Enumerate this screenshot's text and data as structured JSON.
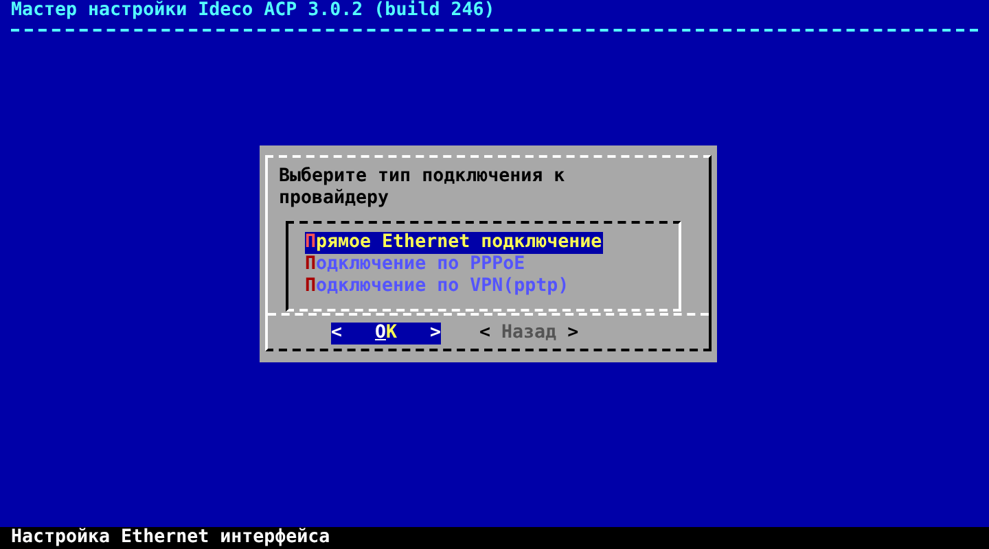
{
  "window": {
    "title": "Мастер настройки Ideco ACP 3.0.2 (build 246)"
  },
  "dialog": {
    "prompt": "Выберите тип подключения к провайдеру",
    "items": [
      {
        "label": "Прямое Ethernet подключение",
        "selected": true
      },
      {
        "label": "Подключение по PPPoE",
        "selected": false
      },
      {
        "label": "Подключение по VPN(pptp)",
        "selected": false
      }
    ],
    "buttons": [
      {
        "left": "<",
        "label": "OK",
        "right": ">",
        "selected": true
      },
      {
        "left": "<",
        "label": "Назад",
        "right": ">",
        "selected": false
      }
    ]
  },
  "status_bar": "Настройка Ethernet интерфейса"
}
